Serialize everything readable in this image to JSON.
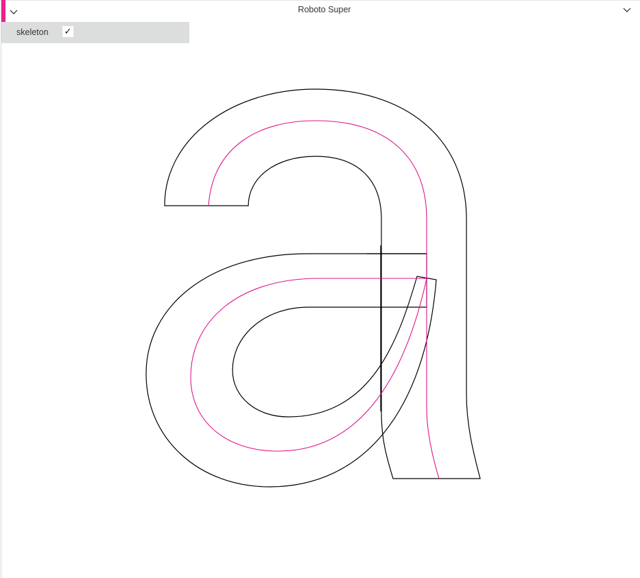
{
  "window": {
    "title": "Roboto Super"
  },
  "panel": {
    "accent_color": "#ec1f8d",
    "controls": [
      {
        "label": "skeleton",
        "checked": true,
        "check_glyph": "✓"
      }
    ]
  },
  "canvas": {
    "glyph": "a",
    "outline_color": "#000000",
    "skeleton_color": "#e0158a"
  }
}
